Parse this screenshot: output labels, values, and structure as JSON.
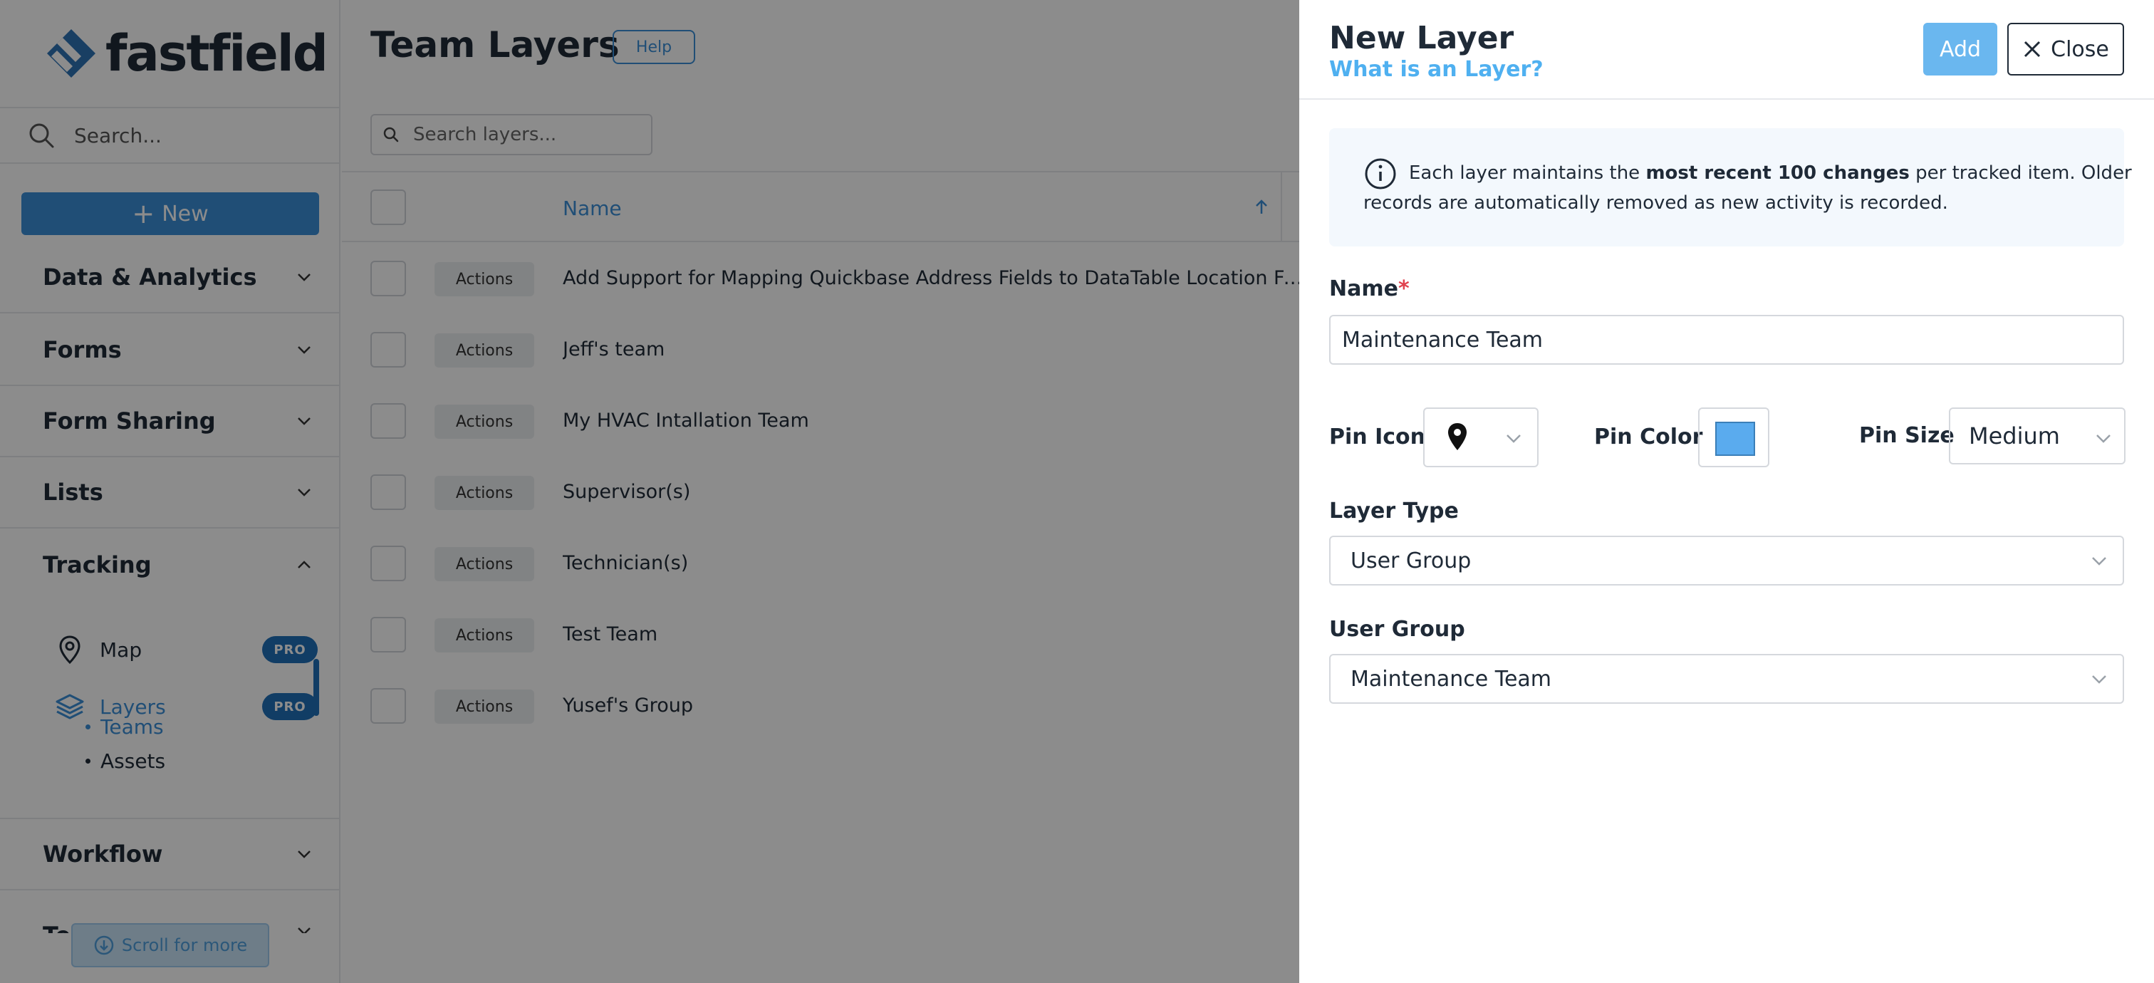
{
  "brand": {
    "name": "fastfield"
  },
  "sidebar": {
    "search_placeholder": "Search...",
    "new_label": "New",
    "sections": [
      {
        "label": "Data & Analytics"
      },
      {
        "label": "Forms"
      },
      {
        "label": "Form Sharing"
      },
      {
        "label": "Lists"
      },
      {
        "label": "Tracking"
      },
      {
        "label": "Workflow"
      },
      {
        "label": "Team"
      }
    ],
    "tracking_items": [
      {
        "label": "Map",
        "badge": "PRO"
      },
      {
        "label": "Layers",
        "badge": "PRO"
      }
    ],
    "layer_subitems": [
      "Teams",
      "Assets"
    ],
    "scroll_more": "Scroll for more"
  },
  "main": {
    "title": "Team Layers",
    "help_label": "Help",
    "search_placeholder": "Search layers...",
    "column_name": "Name",
    "actions_label": "Actions",
    "rows": [
      "Add Support for Mapping Quickbase Address Fields to DataTable Location Fields w...",
      "Jeff's team",
      "My HVAC Intallation Team",
      "Supervisor(s)",
      "Technician(s)",
      "Test Team",
      "Yusef's Group"
    ]
  },
  "drawer": {
    "title": "New Layer",
    "subtitle": "What is an Layer?",
    "add_label": "Add",
    "close_label": "Close",
    "info": {
      "pre": "Each layer maintains the ",
      "bold": "most recent 100 changes",
      "post": " per tracked item. Older",
      "line2": "records are automatically removed as new activity is recorded."
    },
    "name_label": "Name",
    "required_mark": "*",
    "name_value": "Maintenance Team",
    "pin_icon_label": "Pin Icon",
    "pin_icon_value": "map-pin-icon",
    "pin_color_label": "Pin Color",
    "pin_color_value": "#5aabee",
    "pin_size_label": "Pin Size",
    "pin_size_value": "Medium",
    "layer_type_label": "Layer Type",
    "layer_type_value": "User Group",
    "user_group_label": "User Group",
    "user_group_value": "Maintenance Team"
  },
  "colors": {
    "primary": "#3b8fd8",
    "pro_badge": "#1f6fb8",
    "link": "#4fb0f0",
    "add_button": "#6ab7ef",
    "required": "#e0424e"
  }
}
